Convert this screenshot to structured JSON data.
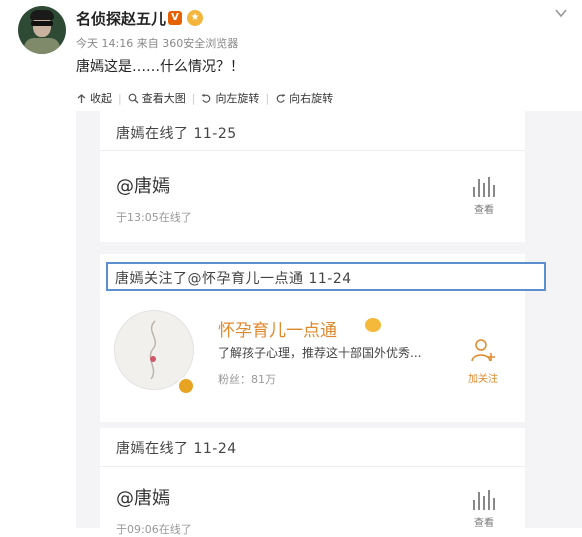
{
  "post": {
    "username": "名侦探赵五儿",
    "verified_badge": "V",
    "timestamp": "今天 14:16",
    "source": "来自 360安全浏览器",
    "text": "唐嫣这是……什么情况？！"
  },
  "toolbar": {
    "collapse_label": "收起",
    "view_large_label": "查看大图",
    "rotate_left_label": "向左旋转",
    "rotate_right_label": "向右旋转"
  },
  "screenshot": {
    "card1": {
      "title": "唐嫣在线了 11-25",
      "handle": "@唐嫣",
      "since": "于13:05在线了",
      "view_label": "查看"
    },
    "card2": {
      "title": "唐嫣关注了@怀孕育儿一点通 11-24",
      "account_name": "怀孕育儿一点通",
      "account_desc": "了解孩子心理，推荐这十部国外优秀...",
      "account_fans": "粉丝：81万",
      "follow_label": "加关注"
    },
    "card3": {
      "title": "唐嫣在线了 11-24",
      "handle": "@唐嫣",
      "since": "于09:06在线了",
      "view_label": "查看"
    }
  },
  "colors": {
    "highlight_border": "#5b8fcf",
    "accent_orange": "#e0892c",
    "verified_orange": "#e66100"
  }
}
